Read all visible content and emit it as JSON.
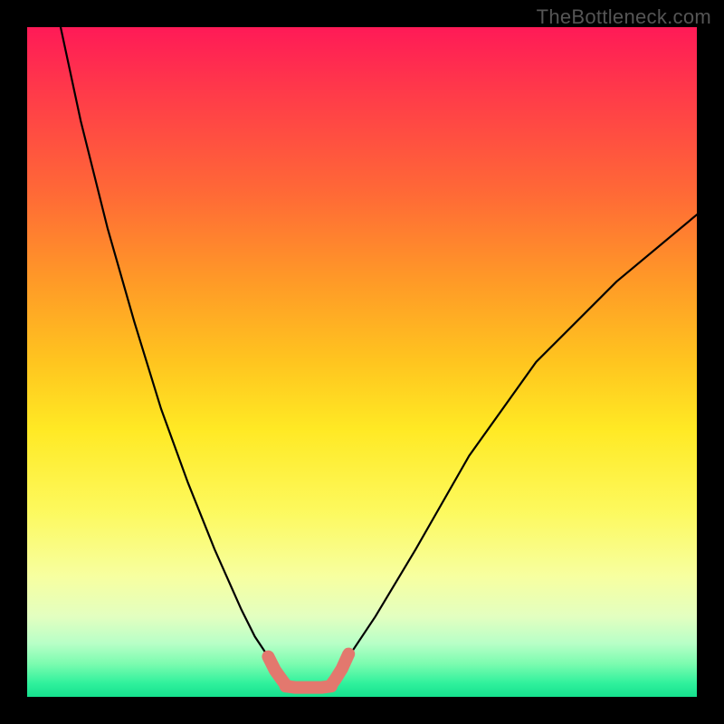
{
  "watermark": "TheBottleneck.com",
  "chart_data": {
    "type": "line",
    "title": "",
    "xlabel": "",
    "ylabel": "",
    "xlim": [
      0,
      100
    ],
    "ylim": [
      0,
      100
    ],
    "grid": false,
    "series": [
      {
        "name": "left-descent",
        "x": [
          5,
          8,
          12,
          16,
          20,
          24,
          28,
          32,
          34,
          36,
          37.5
        ],
        "y": [
          100,
          86,
          70,
          56,
          43,
          32,
          22,
          13,
          9,
          6,
          4
        ]
      },
      {
        "name": "right-ascent",
        "x": [
          46,
          48,
          52,
          58,
          66,
          76,
          88,
          100
        ],
        "y": [
          4,
          6,
          12,
          22,
          36,
          50,
          62,
          72
        ]
      },
      {
        "name": "left-highlight",
        "x": [
          36,
          37,
          38,
          38.6
        ],
        "y": [
          6,
          4,
          2.6,
          1.8
        ]
      },
      {
        "name": "bottom-highlight",
        "x": [
          38.6,
          40,
          42,
          44,
          45.4
        ],
        "y": [
          1.6,
          1.4,
          1.4,
          1.4,
          1.6
        ]
      },
      {
        "name": "right-highlight",
        "x": [
          45.4,
          46,
          47,
          48
        ],
        "y": [
          1.8,
          2.6,
          4.2,
          6.4
        ]
      }
    ],
    "gradient_stops": [
      {
        "pct": 0,
        "color": "#ff1a57"
      },
      {
        "pct": 25,
        "color": "#ff6a36"
      },
      {
        "pct": 50,
        "color": "#ffc51f"
      },
      {
        "pct": 75,
        "color": "#f9ff80"
      },
      {
        "pct": 100,
        "color": "#16e08e"
      }
    ],
    "highlight_color": "#e3786e",
    "curve_color": "#000000"
  }
}
